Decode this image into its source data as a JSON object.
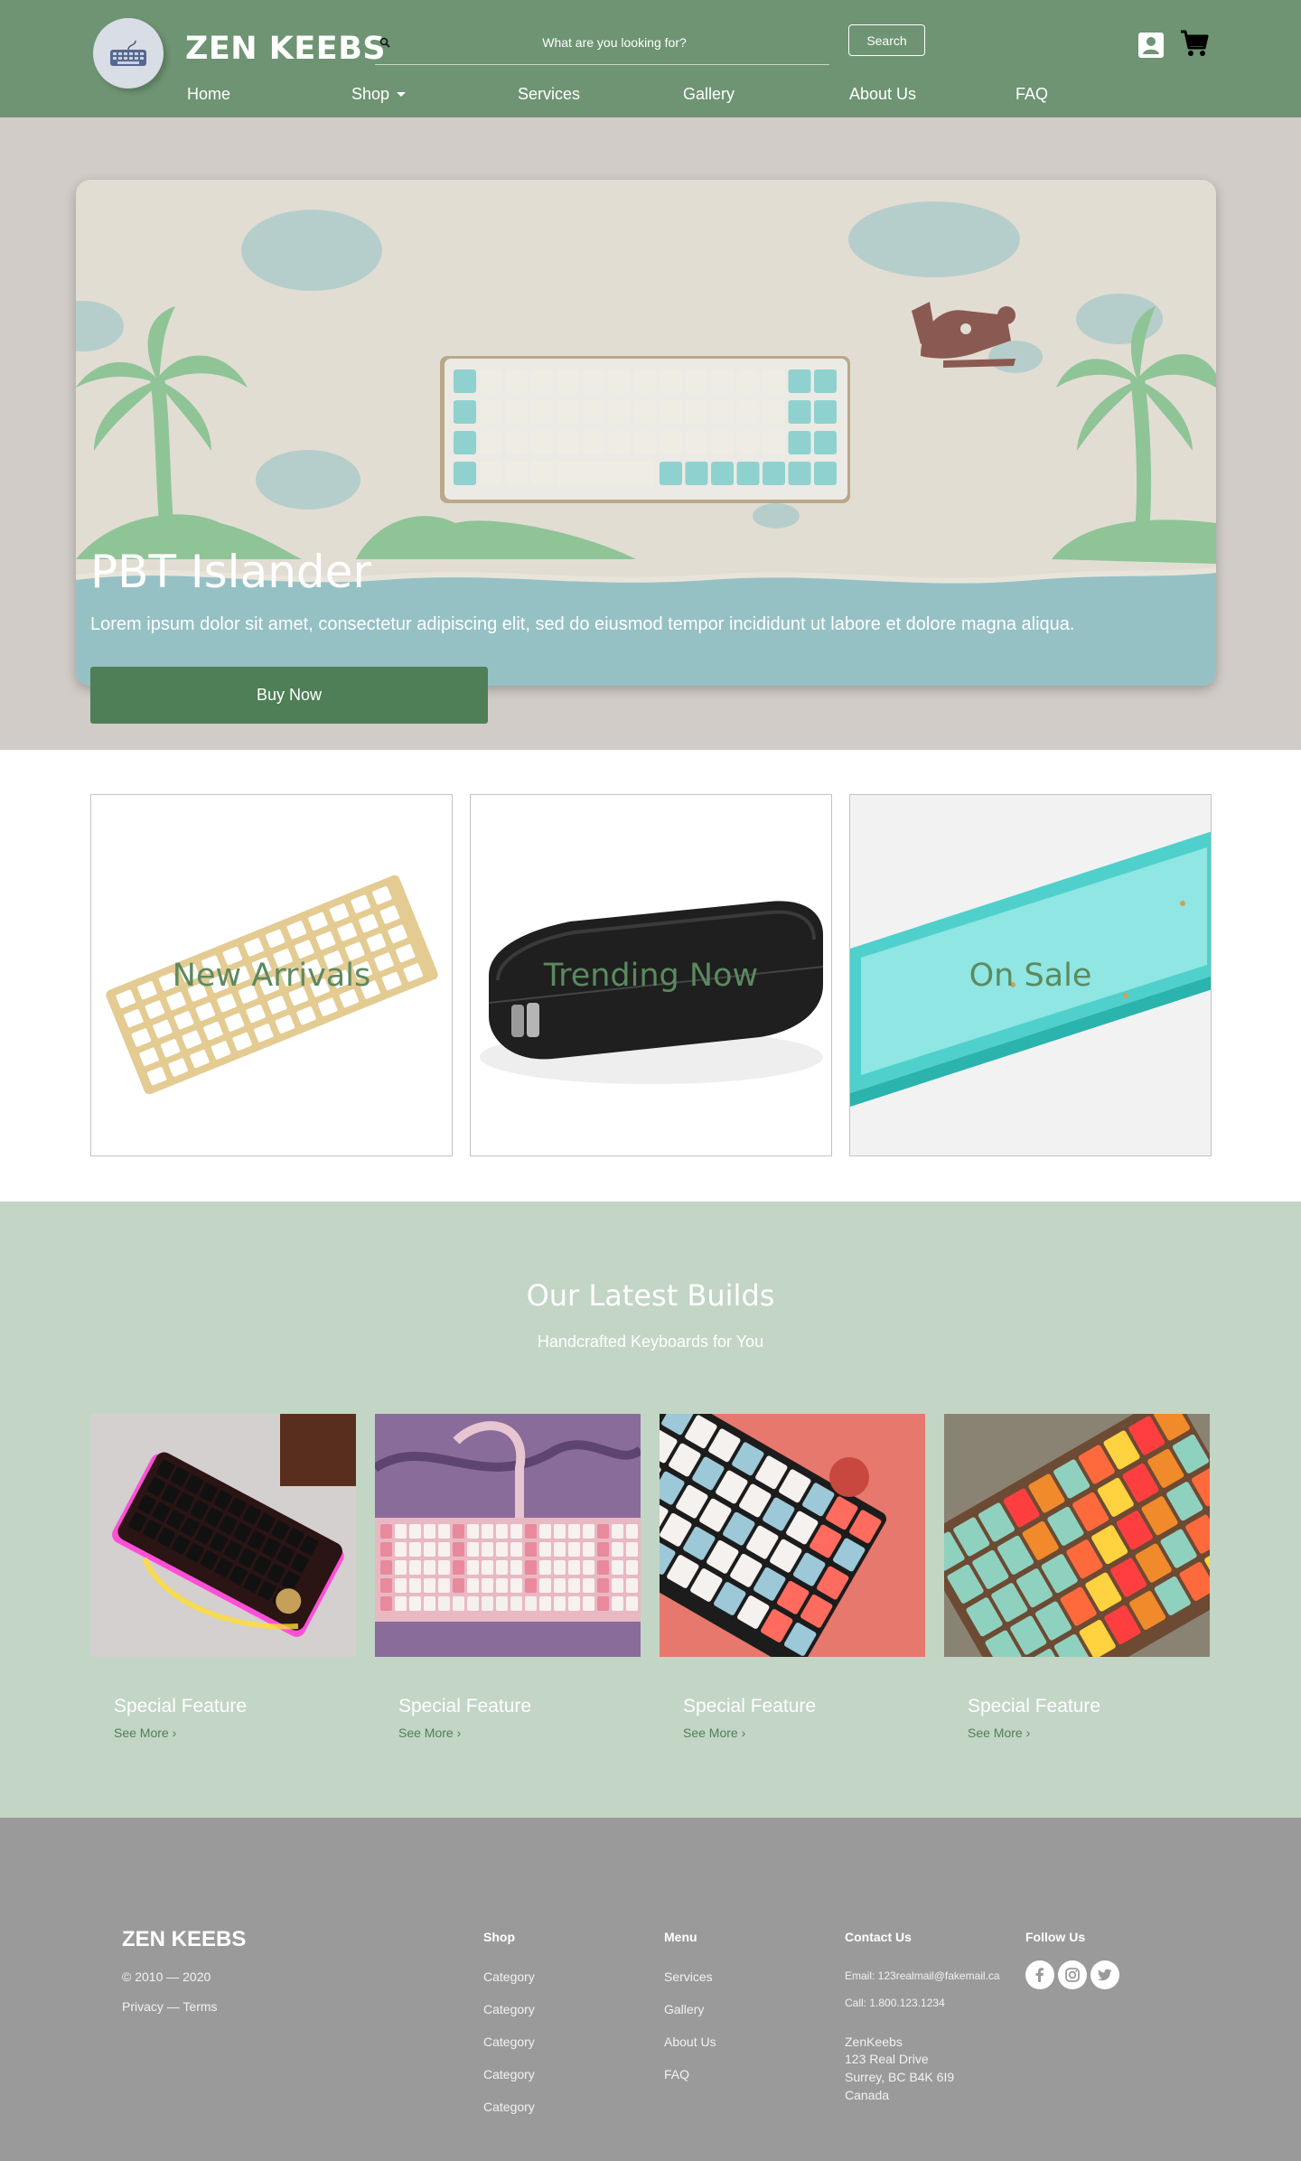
{
  "header": {
    "brand": "ZEN KEEBS",
    "search_placeholder": "What are you looking for?",
    "search_button": "Search",
    "nav": [
      {
        "label": "Home"
      },
      {
        "label": "Shop"
      },
      {
        "label": "Services"
      },
      {
        "label": "Gallery"
      },
      {
        "label": "About Us"
      },
      {
        "label": "FAQ"
      }
    ],
    "icons": [
      "keyboard-logo-icon",
      "search-icon",
      "account-icon",
      "cart-icon",
      "caret-down-icon"
    ]
  },
  "hero": {
    "title": "PBT Islander",
    "description": "Lorem ipsum dolor sit amet, consectetur adipiscing elit, sed do eiusmod tempor incididunt ut labore et dolore magna aliqua.",
    "cta": "Buy Now"
  },
  "categories": [
    {
      "label": "New Arrivals"
    },
    {
      "label": "Trending Now"
    },
    {
      "label": "On Sale"
    }
  ],
  "builds": {
    "title": "Our Latest Builds",
    "subtitle": "Handcrafted Keyboards for You",
    "items": [
      {
        "title": "Special Feature",
        "link": "See More ›"
      },
      {
        "title": "Special Feature",
        "link": "See More ›"
      },
      {
        "title": "Special Feature",
        "link": "See More ›"
      },
      {
        "title": "Special Feature",
        "link": "See More ›"
      }
    ]
  },
  "footer": {
    "brand": "ZEN KEEBS",
    "copyright": "© 2010 — 2020",
    "legal": "Privacy — Terms",
    "shop": {
      "heading": "Shop",
      "items": [
        "Category",
        "Category",
        "Category",
        "Category",
        "Category"
      ]
    },
    "menu": {
      "heading": "Menu",
      "items": [
        "Services",
        "Gallery",
        "About Us",
        "FAQ"
      ]
    },
    "contact": {
      "heading": "Contact Us",
      "email": "Email: 123realmail@fakemail.ca",
      "phone": "Call: 1.800.123.1234",
      "company": "ZenKeebs",
      "address": [
        "123 Real Drive",
        "Surrey, BC B4K 6I9",
        "Canada"
      ]
    },
    "follow": {
      "heading": "Follow Us",
      "icons": [
        "facebook-icon",
        "instagram-icon",
        "twitter-icon"
      ]
    }
  },
  "colors": {
    "header_green": "#6e9473",
    "button_green": "#4f7f56",
    "builds_bg": "#c3d5c5",
    "footer_bg": "#9a9a9a",
    "hero_bg": "#d1ccc8"
  }
}
